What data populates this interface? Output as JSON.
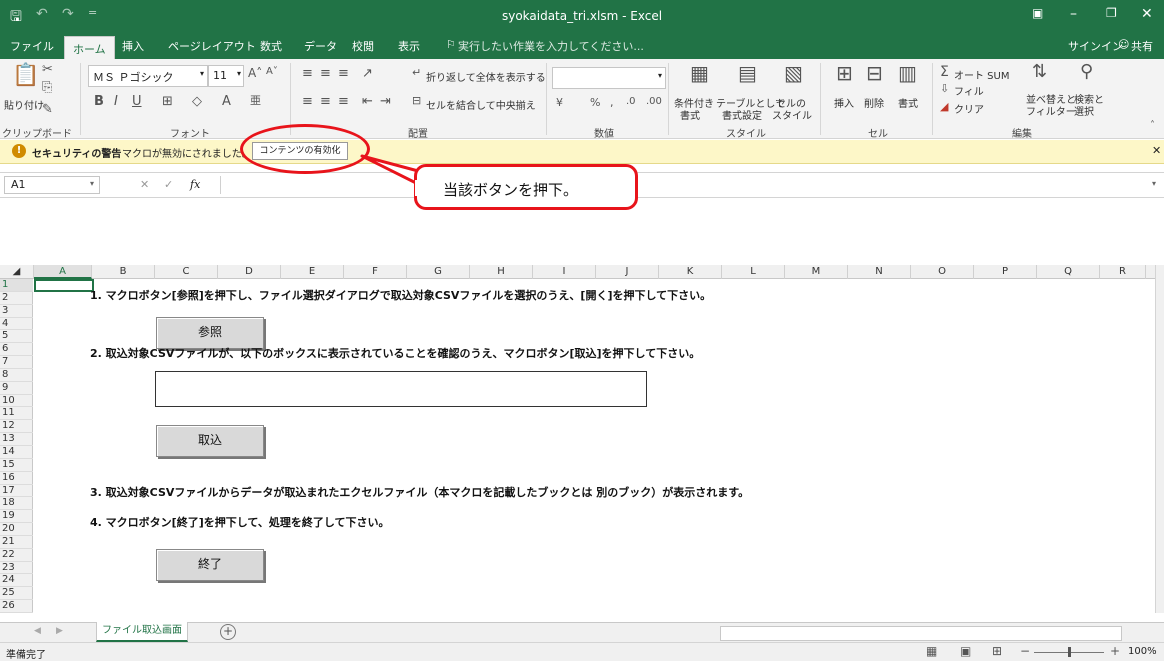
{
  "titlebar": {
    "title": "syokaidata_tri.xlsm - Excel",
    "save_icon": "save-icon",
    "undo_icon": "undo-icon",
    "redo_icon": "redo-icon"
  },
  "tabs": [
    "ファイル",
    "ホーム",
    "挿入",
    "ページレイアウト",
    "数式",
    "データ",
    "校閲",
    "表示"
  ],
  "active_tab": "ホーム",
  "tell_me": "実行したい作業を入力してください...",
  "signin": "サインイン",
  "share": "共有",
  "ribbon": {
    "clipboard": {
      "label": "クリップボード",
      "paste": "貼り付け"
    },
    "font": {
      "label": "フォント",
      "name": "ＭＳ Ｐゴシック",
      "size": "11"
    },
    "alignment": {
      "label": "配置",
      "wrap": "折り返して全体を表示する",
      "merge": "セルを結合して中央揃え"
    },
    "number": {
      "label": "数値"
    },
    "styles": {
      "label": "スタイル",
      "conditional": "条件付き",
      "conditional2": "書式",
      "table": "テーブルとして",
      "table2": "書式設定",
      "cell": "セルの",
      "cell2": "スタイル"
    },
    "cells": {
      "label": "セル",
      "insert": "挿入",
      "delete": "削除",
      "format": "書式"
    },
    "editing": {
      "label": "編集",
      "autosum": "オート SUM",
      "fill": "フィル",
      "clear": "クリア",
      "sort": "並べ替えと",
      "sort2": "フィルター",
      "find": "検索と",
      "find2": "選択"
    }
  },
  "security": {
    "title": "セキュリティの警告",
    "message": "マクロが無効にされました。",
    "button": "コンテンツの有効化"
  },
  "formula": {
    "cell_ref": "A1",
    "fx": "fx",
    "value": ""
  },
  "columns": [
    "A",
    "B",
    "C",
    "D",
    "E",
    "F",
    "G",
    "H",
    "I",
    "J",
    "K",
    "L",
    "M",
    "N",
    "O",
    "P",
    "Q",
    "R"
  ],
  "rows": [
    "1",
    "2",
    "3",
    "4",
    "5",
    "6",
    "7",
    "8",
    "9",
    "10",
    "11",
    "12",
    "13",
    "14",
    "15",
    "16",
    "17",
    "18",
    "19",
    "20",
    "21",
    "22",
    "23",
    "24",
    "25",
    "26"
  ],
  "sheet": {
    "step1": "1. マクロボタン[参照]を押下し、ファイル選択ダイアログで取込対象CSVファイルを選択のうえ、[開く]を押下して下さい。",
    "browse_button": "参照",
    "step2": "2. 取込対象CSVファイルが、以下のボックスに表示されていることを確認のうえ、マクロボタン[取込]を押下して下さい。",
    "path_box": "",
    "import_button": "取込",
    "step3": "3. 取込対象CSVファイルからデータが取込まれたエクセルファイル（本マクロを記載したブックとは 別のブック）が表示されます。",
    "step4": "4. マクロボタン[終了]を押下して、処理を終了して下さい。",
    "end_button": "終了"
  },
  "sheet_tab": "ファイル取込画面",
  "status": {
    "ready": "準備完了",
    "zoom": "100%"
  },
  "callout": "当該ボタンを押下。"
}
